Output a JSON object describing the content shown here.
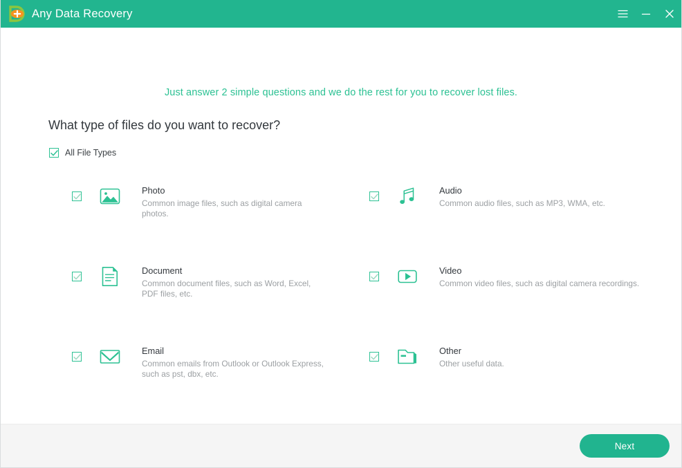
{
  "window": {
    "app_title": "Any Data Recovery",
    "logo_icon": "data-recovery-logo",
    "controls": [
      {
        "name": "menu",
        "icon": "hamburger-menu-icon"
      },
      {
        "name": "minimize",
        "icon": "minimize-icon"
      },
      {
        "name": "close",
        "icon": "close-icon"
      }
    ]
  },
  "main": {
    "tagline": "Just answer 2 simple questions and we do the rest for you to recover lost files.",
    "question": "What type of files do you want to recover?",
    "all_file_types": {
      "label": "All File Types",
      "checked": true
    },
    "file_types": [
      {
        "id": "photo",
        "title": "Photo",
        "description": "Common image files, such as digital camera photos.",
        "icon": "photo-icon",
        "checked": true
      },
      {
        "id": "audio",
        "title": "Audio",
        "description": "Common audio files, such as MP3, WMA, etc.",
        "icon": "audio-icon",
        "checked": true
      },
      {
        "id": "document",
        "title": "Document",
        "description": "Common document files, such as Word, Excel, PDF files, etc.",
        "icon": "document-icon",
        "checked": true
      },
      {
        "id": "video",
        "title": "Video",
        "description": "Common video files, such as digital camera recordings.",
        "icon": "video-icon",
        "checked": true
      },
      {
        "id": "email",
        "title": "Email",
        "description": "Common emails from Outlook or Outlook Express, such as pst, dbx, etc.",
        "icon": "email-icon",
        "checked": true
      },
      {
        "id": "other",
        "title": "Other",
        "description": "Other useful data.",
        "icon": "folder-icon",
        "checked": true
      }
    ]
  },
  "footer": {
    "next_label": "Next"
  },
  "colors": {
    "brand_green": "#22b58f",
    "accent_green": "#2cc193",
    "tagline_green": "#2cc193",
    "title_text": "#33383d",
    "desc_text": "#9b9fa2",
    "footer_bg": "#f5f5f5",
    "logo_orange": "#f5931e",
    "logo_yellow": "#8cc63f"
  }
}
